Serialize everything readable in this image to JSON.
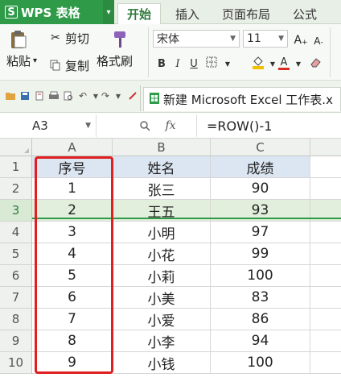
{
  "app": {
    "name": "WPS 表格",
    "logo_glyph": "S"
  },
  "menu": {
    "tabs": [
      {
        "label": "开始",
        "active": true
      },
      {
        "label": "插入",
        "active": false
      },
      {
        "label": "页面布局",
        "active": false
      },
      {
        "label": "公式",
        "active": false
      }
    ]
  },
  "ribbon": {
    "paste_label": "粘贴",
    "paste_caret": "▾",
    "cut_label": "剪切",
    "copy_label": "复制",
    "format_painter_label": "格式刷",
    "font_name": "宋体",
    "font_size": "11",
    "grow_font": "A",
    "shrink_font": "A",
    "bold": "B",
    "italic": "I",
    "underline": "U",
    "font_color_letter": "A",
    "colors": {
      "font_color": "#d62d20",
      "fill_color": "#f2c200"
    }
  },
  "document": {
    "tab_title": "新建 Microsoft Excel 工作表.x"
  },
  "formula": {
    "cell_ref": "A3",
    "fx": "fx",
    "value": "=ROW()-1"
  },
  "grid": {
    "columns": [
      "A",
      "B",
      "C"
    ],
    "rows": [
      "1",
      "2",
      "3",
      "4",
      "5",
      "6",
      "7",
      "8",
      "9",
      "10"
    ],
    "selected_row": "3",
    "data": [
      [
        "序号",
        "姓名",
        "成绩"
      ],
      [
        "1",
        "张三",
        "90"
      ],
      [
        "2",
        "王五",
        "93"
      ],
      [
        "3",
        "小明",
        "97"
      ],
      [
        "4",
        "小花",
        "99"
      ],
      [
        "5",
        "小莉",
        "100"
      ],
      [
        "6",
        "小美",
        "83"
      ],
      [
        "7",
        "小爱",
        "86"
      ],
      [
        "8",
        "小李",
        "94"
      ],
      [
        "9",
        "小钱",
        "100"
      ]
    ],
    "highlight_color": "#e02020",
    "accent_color": "#2f9b49"
  }
}
